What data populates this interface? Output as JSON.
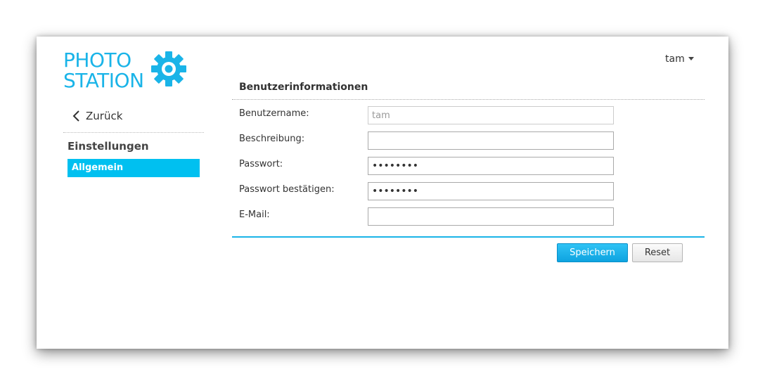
{
  "logo": {
    "line1": "PHOTO",
    "line2": "STATION",
    "icon": "gear-icon",
    "color": "#1ab4e8"
  },
  "sidebar": {
    "back_label": "Zurück",
    "back_icon": "chevron-left-icon",
    "heading": "Einstellungen",
    "items": [
      {
        "label": "Allgemein",
        "active": true
      }
    ],
    "active_color": "#00c0f0"
  },
  "user_menu": {
    "label": "tam",
    "icon": "caret-down-icon"
  },
  "form": {
    "title": "Benutzerinformationen",
    "fields": [
      {
        "label": "Benutzername:",
        "value": "tam",
        "disabled": true
      },
      {
        "label": "Beschreibung:",
        "value": ""
      },
      {
        "label": "Passwort:",
        "value": "••••••••",
        "type": "password"
      },
      {
        "label": "Passwort bestätigen:",
        "value": "••••••••",
        "type": "password"
      },
      {
        "label": "E-Mail:",
        "value": ""
      }
    ],
    "save_label": "Speichern",
    "reset_label": "Reset",
    "accent_color": "#1ab4e8"
  }
}
